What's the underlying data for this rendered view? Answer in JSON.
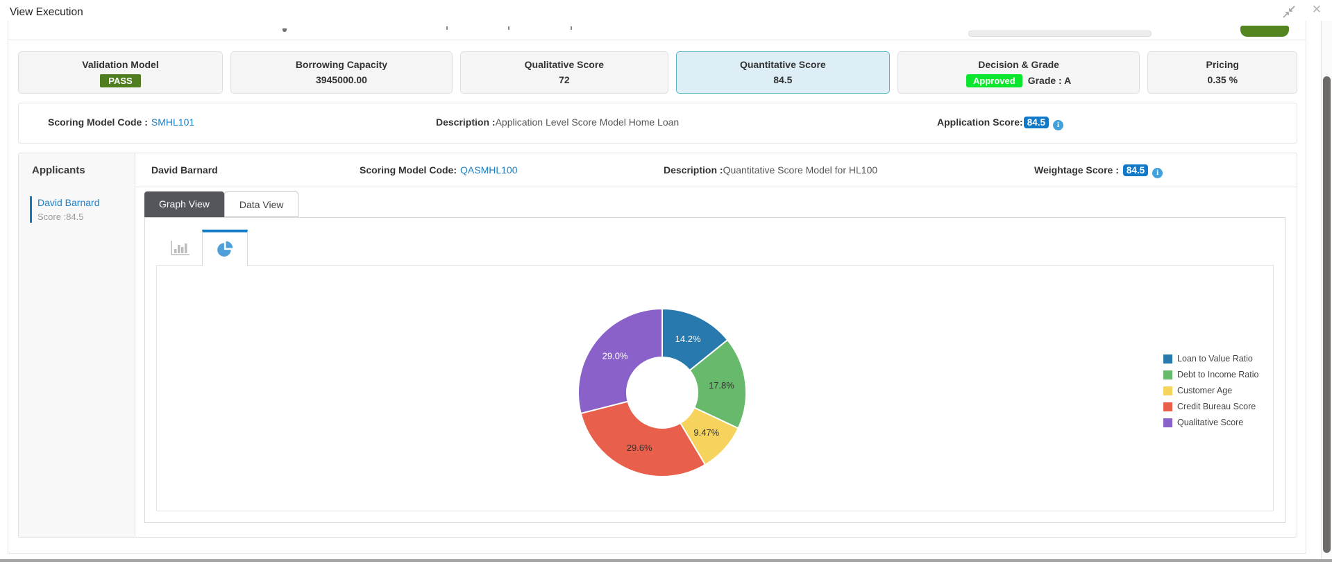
{
  "window": {
    "title": "View Execution"
  },
  "summary_cards": [
    {
      "label": "Validation Model",
      "badge": "PASS"
    },
    {
      "label": "Borrowing Capacity",
      "value": "3945000.00"
    },
    {
      "label": "Qualitative Score",
      "value": "72"
    },
    {
      "label": "Quantitative Score",
      "value": "84.5",
      "selected": true
    },
    {
      "label": "Decision & Grade",
      "badge": "Approved",
      "value": "Grade : A"
    },
    {
      "label": "Pricing",
      "value": "0.35 %"
    }
  ],
  "application_summary": {
    "scoring_model_code_label": "Scoring Model Code :",
    "scoring_model_code": "SMHL101",
    "description_label": "Description :",
    "description": "Application Level Score Model Home Loan",
    "application_score_label": "Application Score:",
    "application_score": "84.5"
  },
  "applicants": {
    "heading": "Applicants",
    "items": [
      {
        "name": "David Barnard",
        "score": "Score :84.5",
        "selected": true
      }
    ]
  },
  "applicant_detail": {
    "name": "David Barnard",
    "scoring_model_code_label": "Scoring Model Code:",
    "scoring_model_code": "QASMHL100",
    "description_label": "Description :",
    "description": "Quantitative Score Model for HL100",
    "weightage_score_label": "Weightage Score :",
    "weightage_score": "84.5"
  },
  "view_tabs": [
    {
      "label": "Graph View",
      "active": true
    },
    {
      "label": "Data View",
      "active": false
    }
  ],
  "chart_tabs": [
    {
      "name": "bar-chart",
      "active": false
    },
    {
      "name": "pie-chart",
      "active": true
    }
  ],
  "chart_data": {
    "type": "pie",
    "variant": "donut",
    "labels": [
      "Loan to Value Ratio",
      "Debt to Income Ratio",
      "Customer Age",
      "Credit Bureau Score",
      "Qualitative Score"
    ],
    "values": [
      14.2,
      17.8,
      9.47,
      29.6,
      29.0
    ],
    "value_labels": [
      "14.2%",
      "17.8%",
      "9.47%",
      "29.6%",
      "29.0%"
    ],
    "colors": [
      "#2779ae",
      "#67ba6b",
      "#f5d35c",
      "#e8604b",
      "#8a61c8"
    ],
    "label_text_colors": [
      "#ffffff",
      "#333333",
      "#333333",
      "#333333",
      "#ffffff"
    ],
    "legend_position": "right",
    "start_angle_deg": 0,
    "clockwise": true,
    "inner_radius_ratio": 0.42
  },
  "colors": {
    "link_blue": "#1d7fc4",
    "score_badge_blue": "#1278c8",
    "pass_green": "#4f7d20",
    "approved_green": "#0ae52e",
    "active_tab_dark": "#54565c",
    "chart_tab_accent": "#137bc8",
    "selected_card_bg": "#ddeef7",
    "selected_card_border": "#5ab5c8"
  }
}
